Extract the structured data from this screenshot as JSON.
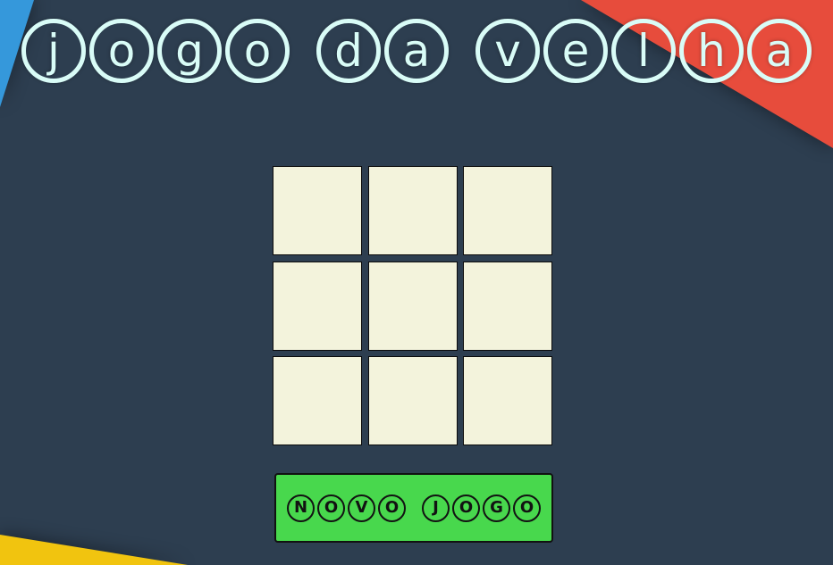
{
  "title": {
    "words": [
      "jogo",
      "da",
      "velha"
    ]
  },
  "board": {
    "cells": [
      "",
      "",
      "",
      "",
      "",
      "",
      "",
      "",
      ""
    ]
  },
  "new_game_button": {
    "words": [
      "NOVO",
      "JOGO"
    ]
  },
  "colors": {
    "background": "#2d3e50",
    "title_text": "#d9fcf7",
    "cell_fill": "#f3f3dc",
    "button_fill": "#48d84d",
    "decor_blue": "#3598db",
    "decor_red": "#e74c3c",
    "decor_yellow": "#f1c40f"
  }
}
